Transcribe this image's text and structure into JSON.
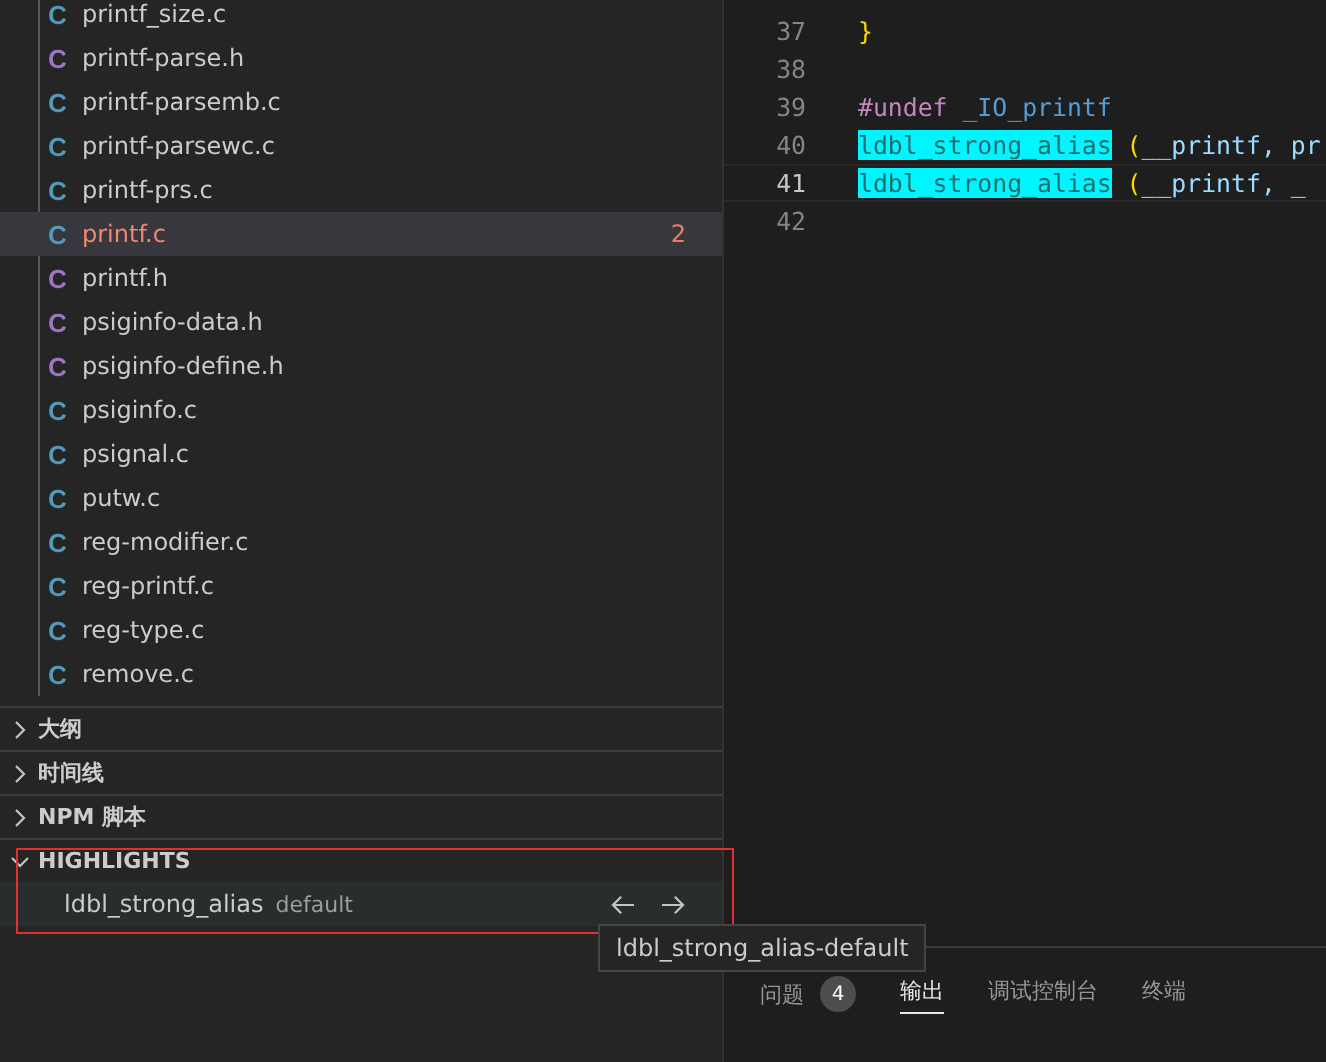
{
  "files": [
    {
      "icon": "C",
      "kind": "c",
      "name": "printf_size.c",
      "selected": false,
      "has_errors": false
    },
    {
      "icon": "C",
      "kind": "h",
      "name": "printf-parse.h",
      "selected": false,
      "has_errors": false
    },
    {
      "icon": "C",
      "kind": "c",
      "name": "printf-parsemb.c",
      "selected": false,
      "has_errors": false
    },
    {
      "icon": "C",
      "kind": "c",
      "name": "printf-parsewc.c",
      "selected": false,
      "has_errors": false
    },
    {
      "icon": "C",
      "kind": "c",
      "name": "printf-prs.c",
      "selected": false,
      "has_errors": false
    },
    {
      "icon": "C",
      "kind": "c",
      "name": "printf.c",
      "selected": true,
      "has_errors": true,
      "badge": "2"
    },
    {
      "icon": "C",
      "kind": "h",
      "name": "printf.h",
      "selected": false,
      "has_errors": false
    },
    {
      "icon": "C",
      "kind": "h",
      "name": "psiginfo-data.h",
      "selected": false,
      "has_errors": false
    },
    {
      "icon": "C",
      "kind": "h",
      "name": "psiginfo-define.h",
      "selected": false,
      "has_errors": false
    },
    {
      "icon": "C",
      "kind": "c",
      "name": "psiginfo.c",
      "selected": false,
      "has_errors": false
    },
    {
      "icon": "C",
      "kind": "c",
      "name": "psignal.c",
      "selected": false,
      "has_errors": false
    },
    {
      "icon": "C",
      "kind": "c",
      "name": "putw.c",
      "selected": false,
      "has_errors": false
    },
    {
      "icon": "C",
      "kind": "c",
      "name": "reg-modifier.c",
      "selected": false,
      "has_errors": false
    },
    {
      "icon": "C",
      "kind": "c",
      "name": "reg-printf.c",
      "selected": false,
      "has_errors": false
    },
    {
      "icon": "C",
      "kind": "c",
      "name": "reg-type.c",
      "selected": false,
      "has_errors": false
    },
    {
      "icon": "C",
      "kind": "c",
      "name": "remove.c",
      "selected": false,
      "has_errors": false
    }
  ],
  "sections": [
    {
      "label": "大纲",
      "expanded": false
    },
    {
      "label": "时间线",
      "expanded": false
    },
    {
      "label": "NPM 脚本",
      "expanded": false
    },
    {
      "label": "HIGHLIGHTS",
      "expanded": true
    }
  ],
  "highlights": [
    {
      "name": "ldbl_strong_alias",
      "description": "default",
      "selected": true
    }
  ],
  "tooltip": "ldbl_strong_alias-default",
  "code_lines": [
    {
      "number": "37",
      "active": false,
      "tokens": [
        {
          "text": "}",
          "kind": "brace"
        }
      ]
    },
    {
      "number": "38",
      "active": false
    },
    {
      "number": "39",
      "active": false,
      "tokens": [
        {
          "text": "#undef",
          "kind": "keyword"
        },
        {
          "text": " _IO_printf",
          "kind": "macro"
        }
      ]
    },
    {
      "number": "40",
      "active": false,
      "tokens": [
        {
          "text": "ldbl_strong_alias",
          "kind": "highlight"
        },
        {
          "text": " (",
          "kind": "brace"
        },
        {
          "text": "__printf",
          "kind": "variable"
        },
        {
          "text": ", pr",
          "kind": "variable"
        }
      ]
    },
    {
      "number": "41",
      "active": true,
      "tokens": [
        {
          "text": "ldbl_strong_alias",
          "kind": "highlight"
        },
        {
          "text": " (",
          "kind": "brace"
        },
        {
          "text": "__printf",
          "kind": "variable"
        },
        {
          "text": ", _",
          "kind": "variable"
        }
      ]
    },
    {
      "number": "42",
      "active": false
    }
  ],
  "panel_tabs": [
    {
      "label": "问题",
      "selected": false,
      "badge": "4"
    },
    {
      "label": "输出",
      "selected": true
    },
    {
      "label": "调试控制台",
      "selected": false
    },
    {
      "label": "终端",
      "selected": false
    }
  ]
}
